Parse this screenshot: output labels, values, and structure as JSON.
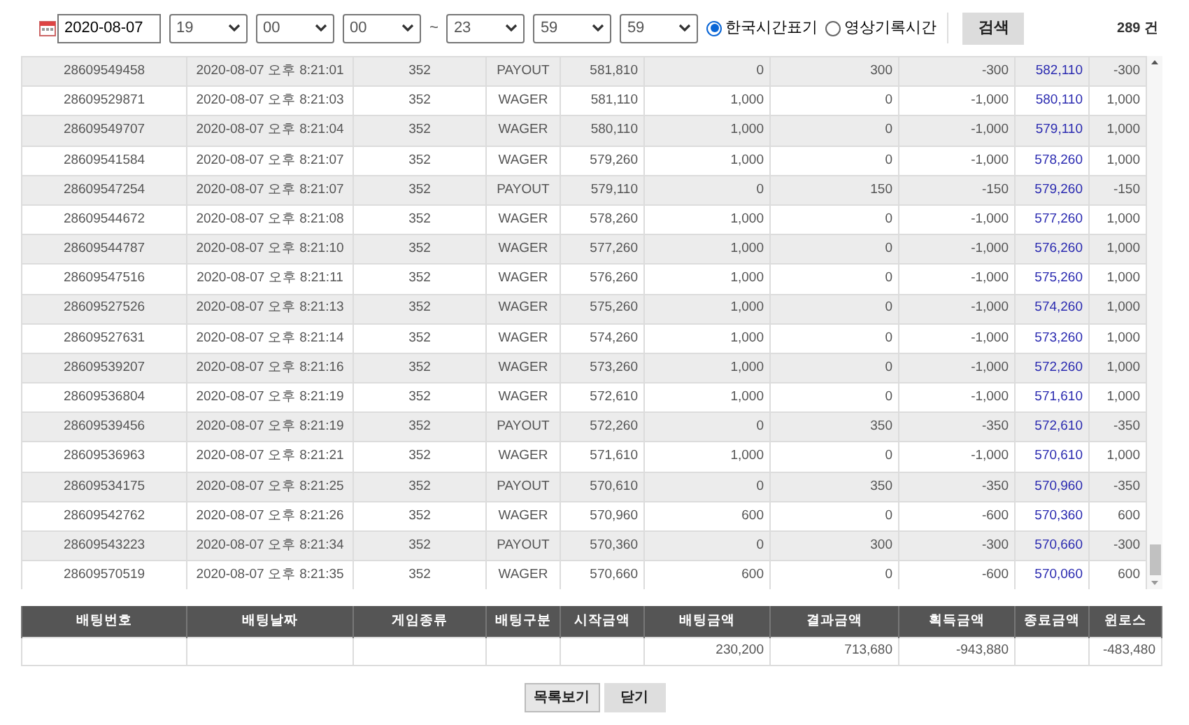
{
  "filter": {
    "date": "2020-08-07",
    "start_time": [
      "19",
      "00",
      "00"
    ],
    "separator": "~",
    "end_time": [
      "23",
      "59",
      "59"
    ],
    "time_modes": [
      {
        "label": "한국시간표기",
        "selected": true
      },
      {
        "label": "영상기록시간",
        "selected": false
      }
    ],
    "search_button": "검색",
    "count": "289 건"
  },
  "rows": [
    [
      "28609549458",
      "2020-08-07 오후 8:21:01",
      "352",
      "PAYOUT",
      "581,810",
      "0",
      "300",
      "-300",
      "582,110",
      "-300"
    ],
    [
      "28609529871",
      "2020-08-07 오후 8:21:03",
      "352",
      "WAGER",
      "581,110",
      "1,000",
      "0",
      "-1,000",
      "580,110",
      "1,000"
    ],
    [
      "28609549707",
      "2020-08-07 오후 8:21:04",
      "352",
      "WAGER",
      "580,110",
      "1,000",
      "0",
      "-1,000",
      "579,110",
      "1,000"
    ],
    [
      "28609541584",
      "2020-08-07 오후 8:21:07",
      "352",
      "WAGER",
      "579,260",
      "1,000",
      "0",
      "-1,000",
      "578,260",
      "1,000"
    ],
    [
      "28609547254",
      "2020-08-07 오후 8:21:07",
      "352",
      "PAYOUT",
      "579,110",
      "0",
      "150",
      "-150",
      "579,260",
      "-150"
    ],
    [
      "28609544672",
      "2020-08-07 오후 8:21:08",
      "352",
      "WAGER",
      "578,260",
      "1,000",
      "0",
      "-1,000",
      "577,260",
      "1,000"
    ],
    [
      "28609544787",
      "2020-08-07 오후 8:21:10",
      "352",
      "WAGER",
      "577,260",
      "1,000",
      "0",
      "-1,000",
      "576,260",
      "1,000"
    ],
    [
      "28609547516",
      "2020-08-07 오후 8:21:11",
      "352",
      "WAGER",
      "576,260",
      "1,000",
      "0",
      "-1,000",
      "575,260",
      "1,000"
    ],
    [
      "28609527526",
      "2020-08-07 오후 8:21:13",
      "352",
      "WAGER",
      "575,260",
      "1,000",
      "0",
      "-1,000",
      "574,260",
      "1,000"
    ],
    [
      "28609527631",
      "2020-08-07 오후 8:21:14",
      "352",
      "WAGER",
      "574,260",
      "1,000",
      "0",
      "-1,000",
      "573,260",
      "1,000"
    ],
    [
      "28609539207",
      "2020-08-07 오후 8:21:16",
      "352",
      "WAGER",
      "573,260",
      "1,000",
      "0",
      "-1,000",
      "572,260",
      "1,000"
    ],
    [
      "28609536804",
      "2020-08-07 오후 8:21:19",
      "352",
      "WAGER",
      "572,610",
      "1,000",
      "0",
      "-1,000",
      "571,610",
      "1,000"
    ],
    [
      "28609539456",
      "2020-08-07 오후 8:21:19",
      "352",
      "PAYOUT",
      "572,260",
      "0",
      "350",
      "-350",
      "572,610",
      "-350"
    ],
    [
      "28609536963",
      "2020-08-07 오후 8:21:21",
      "352",
      "WAGER",
      "571,610",
      "1,000",
      "0",
      "-1,000",
      "570,610",
      "1,000"
    ],
    [
      "28609534175",
      "2020-08-07 오후 8:21:25",
      "352",
      "PAYOUT",
      "570,610",
      "0",
      "350",
      "-350",
      "570,960",
      "-350"
    ],
    [
      "28609542762",
      "2020-08-07 오후 8:21:26",
      "352",
      "WAGER",
      "570,960",
      "600",
      "0",
      "-600",
      "570,360",
      "600"
    ],
    [
      "28609543223",
      "2020-08-07 오후 8:21:34",
      "352",
      "PAYOUT",
      "570,360",
      "0",
      "300",
      "-300",
      "570,660",
      "-300"
    ],
    [
      "28609570519",
      "2020-08-07 오후 8:21:35",
      "352",
      "WAGER",
      "570,660",
      "600",
      "0",
      "-600",
      "570,060",
      "600"
    ]
  ],
  "summary": {
    "columns": [
      "배팅번호",
      "배팅날짜",
      "게임종류",
      "배팅구분",
      "시작금액",
      "배팅금액",
      "결과금액",
      "획득금액",
      "종료금액",
      "윈로스"
    ],
    "totals": {
      "bet_amount": "230,200",
      "result_amount": "713,680",
      "gain_amount": "-943,880",
      "win_loss": "-483,480"
    }
  },
  "buttons": [
    "목록보기",
    "닫기"
  ]
}
